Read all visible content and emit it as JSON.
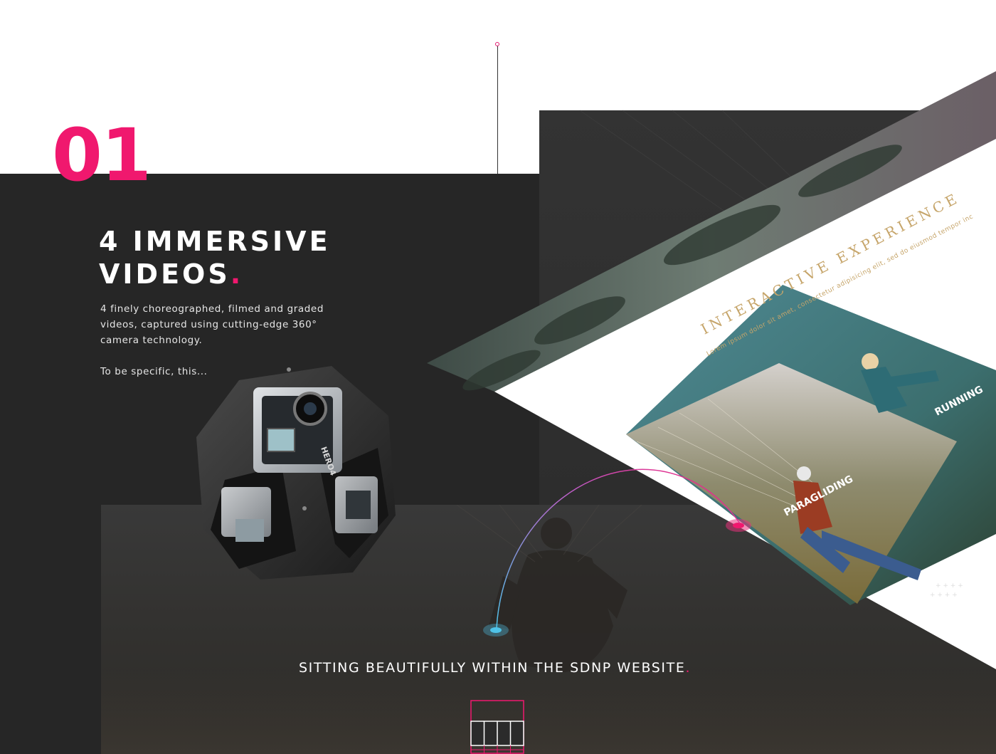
{
  "section": {
    "number": "01",
    "title_line1": "4 IMMERSIVE",
    "title_line2": "VIDEOS",
    "title_dot": ".",
    "description": "4 finely choreographed, filmed and graded videos, captured using cutting-edge 360° camera technology.",
    "aside": "To be specific, this..."
  },
  "camera": {
    "label": "HERO4"
  },
  "mockup": {
    "heading": "INTERACTIVE EXPERIENCE",
    "subheading": "Lorem ipsum dolor sit amet, consectetur adipisicing elit, sed do eiusmod tempor inc",
    "card_paragliding": "PARAGLIDING",
    "card_running": "RUNNING"
  },
  "caption": {
    "text": "SITTING BEAUTIFULLY WITHIN THE SDNP WEBSITE",
    "dot": "."
  },
  "colors": {
    "accent": "#f0186e",
    "dark_background": "#262626",
    "connector_blue": "#4fc3e8",
    "heading_gold": "#c6a56a"
  },
  "icons": {
    "camera": "360-camera-rig-icon",
    "grid": "video-grid-icon"
  }
}
